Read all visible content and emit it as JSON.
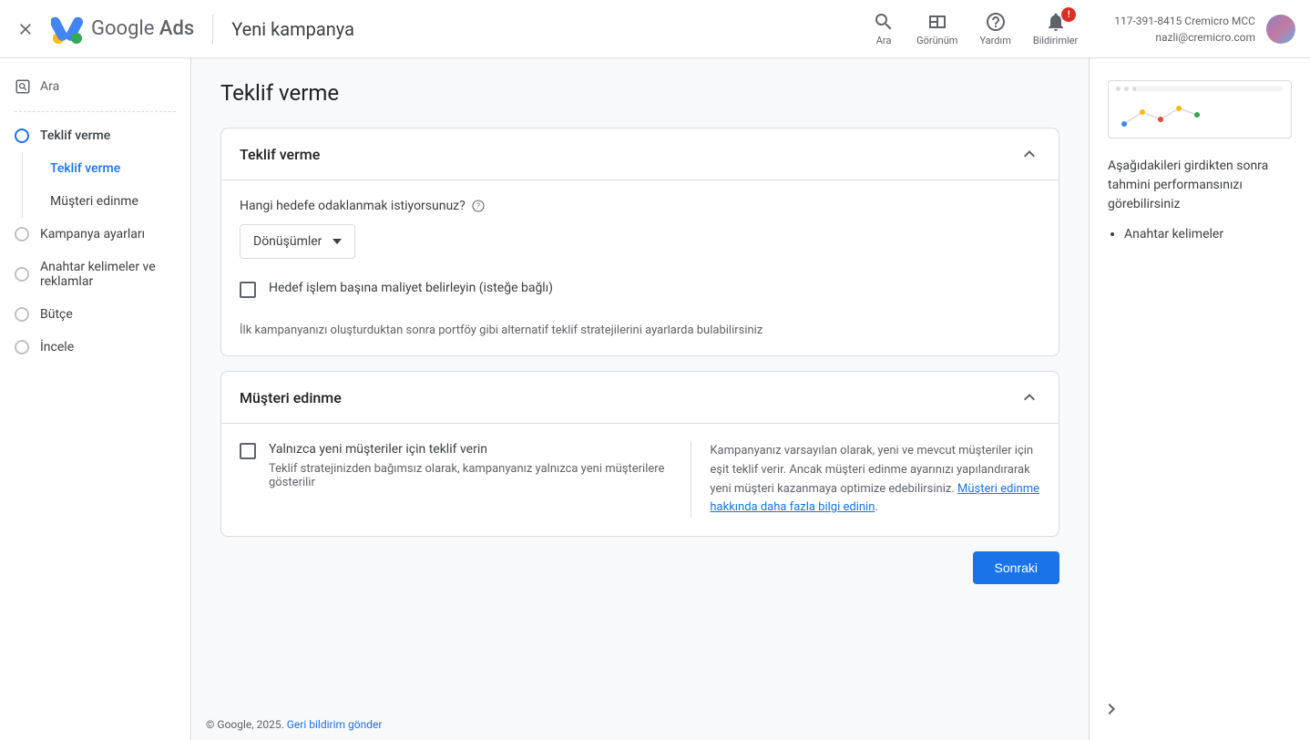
{
  "header": {
    "logo_text_1": "Google",
    "logo_text_2": " Ads",
    "page_title": "Yeni kampanya",
    "actions": {
      "search": "Ara",
      "view": "Görünüm",
      "help": "Yardım",
      "notifications": "Bildirimler",
      "badge": "!"
    },
    "account": {
      "line1": "117-391-8415 Cremicro MCC",
      "line2": "nazli@cremicro.com"
    }
  },
  "sidebar": {
    "search_label": "Ara",
    "items": [
      {
        "label": "Teklif verme",
        "sub": [
          {
            "label": "Teklif verme"
          },
          {
            "label": "Müşteri edinme"
          }
        ]
      },
      {
        "label": "Kampanya ayarları"
      },
      {
        "label": "Anahtar kelimeler ve reklamlar"
      },
      {
        "label": "Bütçe"
      },
      {
        "label": "İncele"
      }
    ]
  },
  "content": {
    "title": "Teklif verme",
    "card1": {
      "title": "Teklif verme",
      "question": "Hangi hedefe odaklanmak istiyorsunuz?",
      "select_value": "Dönüşümler",
      "checkbox_label": "Hedef işlem başına maliyet belirleyin (isteğe bağlı)",
      "footer_text": "İlk kampanyanızı oluşturduktan sonra portföy gibi alternatif teklif stratejilerini ayarlarda bulabilirsiniz"
    },
    "card2": {
      "title": "Müşteri edinme",
      "checkbox_label": "Yalnızca yeni müşteriler için teklif verin",
      "checkbox_sublabel": "Teklif stratejinizden bağımsız olarak, kampanyanız yalnızca yeni müşterilere gösterilir",
      "info_text": "Kampanyanız varsayılan olarak, yeni ve mevcut müşteriler için eşit teklif verir. Ancak müşteri edinme ayarınızı yapılandırarak yeni müşteri kazanmaya optimize edebilirsiniz. ",
      "info_link": "Müşteri edinme hakkında daha fazla bilgi edinin",
      "info_period": "."
    },
    "next_button": "Sonraki"
  },
  "right_panel": {
    "info": "Aşağıdakileri girdikten sonra tahmini performansınızı görebilirsiniz",
    "bullet": "Anahtar kelimeler"
  },
  "footer": {
    "copyright": "© Google, 2025. ",
    "feedback_link": "Geri bildirim gönder"
  }
}
